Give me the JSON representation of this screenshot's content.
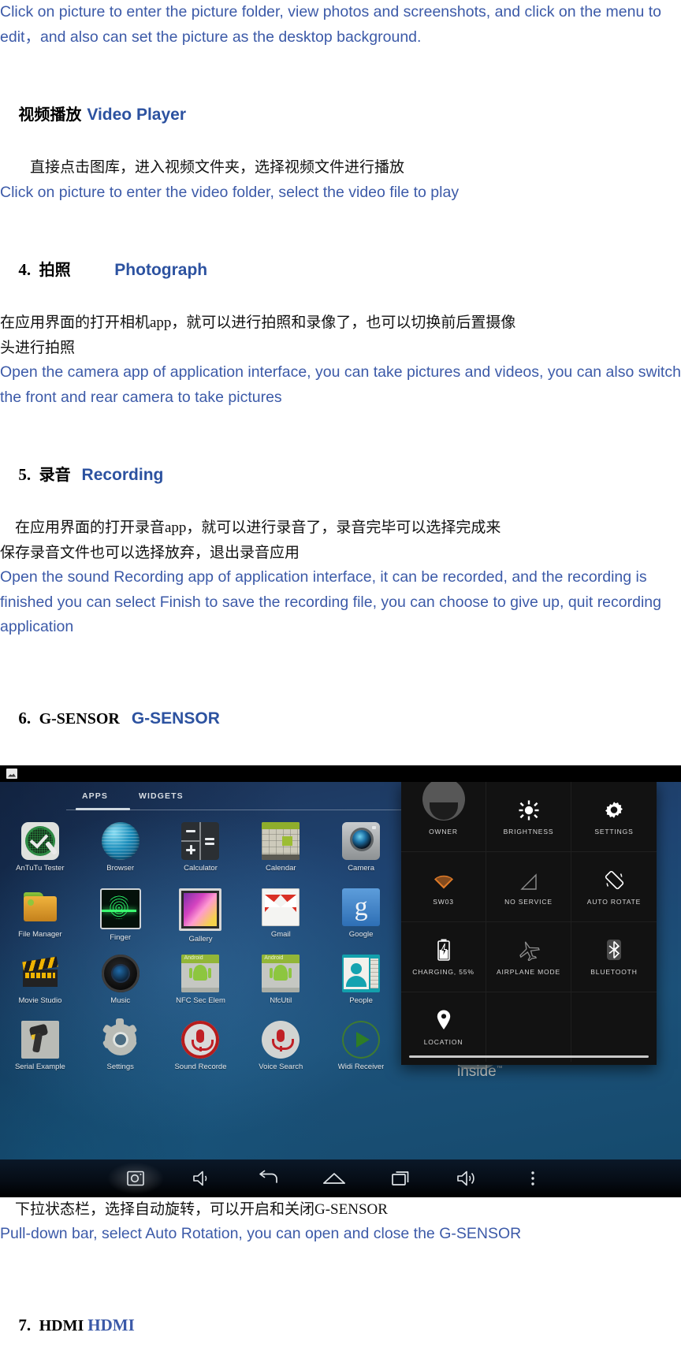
{
  "doc": {
    "para_gallery_en": "Click on picture to enter the picture folder, view photos and screenshots, and click on the menu to edit，and also can set the picture as the desktop background.",
    "video_section": {
      "heading_cn": "视频播放",
      "heading_en": "Video Player",
      "body_cn": "        直接点击图库，进入视频文件夹，选择视频文件进行播放",
      "body_en": "Click on picture to enter the video folder, select the video file to play"
    },
    "photo_section": {
      "number": "4.",
      "heading_cn": "拍照",
      "heading_en": "Photograph",
      "body_cn": "在应用界面的打开相机app，就可以进行拍照和录像了，也可以切换前后置摄像\n头进行拍照",
      "body_en": "Open the camera app of application interface, you can take pictures and videos, you can also switch the front and rear camera to take pictures"
    },
    "recording_section": {
      "number": "5.",
      "heading_cn": "录音",
      "heading_en": "Recording",
      "body_cn": "    在应用界面的打开录音app，就可以进行录音了，录音完毕可以选择完成来\n保存录音文件也可以选择放弃，退出录音应用",
      "body_en": "Open the sound Recording app of application interface, it can be recorded, and the recording is finished you can select Finish to save the recording file, you can choose to give up, quit recording application"
    },
    "gsensor_section": {
      "number": "6.",
      "heading_cn": "G-SENSOR",
      "heading_en": "G-SENSOR",
      "caption_cn": "    下拉状态栏，选择自动旋转，可以开启和关闭G-SENSOR",
      "caption_en": "Pull-down bar, select Auto Rotation, you can open and close the G-SENSOR"
    },
    "hdmi_section": {
      "number": "7.",
      "heading_cn": "HDMI",
      "heading_en": "HDMI"
    }
  },
  "screenshot": {
    "statusbar": {
      "icon": "screenshot-image-icon"
    },
    "launcher": {
      "tabs": [
        {
          "label": "APPS",
          "active": true
        },
        {
          "label": "WIDGETS",
          "active": false
        }
      ],
      "apps": [
        {
          "label": "AnTuTu Tester",
          "icon": "antutu-icon"
        },
        {
          "label": "Browser",
          "icon": "browser-globe-icon"
        },
        {
          "label": "Calculator",
          "icon": "calculator-icon"
        },
        {
          "label": "Calendar",
          "icon": "calendar-icon"
        },
        {
          "label": "Camera",
          "icon": "camera-icon"
        },
        {
          "label": "File Manager",
          "icon": "folder-icon"
        },
        {
          "label": "Finger",
          "icon": "fingerprint-icon"
        },
        {
          "label": "Gallery",
          "icon": "gallery-photo-icon"
        },
        {
          "label": "Gmail",
          "icon": "gmail-envelope-icon"
        },
        {
          "label": "Google",
          "icon": "google-g-icon"
        },
        {
          "label": "Movie Studio",
          "icon": "clapperboard-icon"
        },
        {
          "label": "Music",
          "icon": "speaker-icon"
        },
        {
          "label": "NFC Sec Elem",
          "icon": "android-robot-icon"
        },
        {
          "label": "NfcUtil",
          "icon": "android-robot-icon"
        },
        {
          "label": "People",
          "icon": "contact-card-icon"
        },
        {
          "label": "Serial Example",
          "icon": "barcode-scanner-icon"
        },
        {
          "label": "Settings",
          "icon": "gear-icon"
        },
        {
          "label": "Sound Recorde",
          "icon": "record-microphone-icon"
        },
        {
          "label": "Voice Search",
          "icon": "microphone-icon"
        },
        {
          "label": "Widi Receiver",
          "icon": "play-circle-icon"
        }
      ],
      "wallpaper_logo": "inside",
      "wallpaper_logo_tm": "™"
    },
    "quick_settings": [
      {
        "label": "OWNER",
        "icon": "user-avatar-icon"
      },
      {
        "label": "BRIGHTNESS",
        "icon": "brightness-sun-icon"
      },
      {
        "label": "SETTINGS",
        "icon": "gear-icon"
      },
      {
        "label": "SW03",
        "icon": "wifi-icon"
      },
      {
        "label": "NO SERVICE",
        "icon": "signal-bars-icon"
      },
      {
        "label": "AUTO ROTATE",
        "icon": "auto-rotate-icon"
      },
      {
        "label": "CHARGING, 55%",
        "icon": "battery-charging-icon"
      },
      {
        "label": "AIRPLANE MODE",
        "icon": "airplane-icon"
      },
      {
        "label": "BLUETOOTH",
        "icon": "bluetooth-icon"
      },
      {
        "label": "LOCATION",
        "icon": "location-pin-icon"
      }
    ],
    "navbar": [
      {
        "name": "screenshot-button",
        "icon": "camera-shutter-icon",
        "active": true
      },
      {
        "name": "volume-down-button",
        "icon": "volume-low-icon",
        "active": false
      },
      {
        "name": "back-button",
        "icon": "back-arrow-icon",
        "active": false
      },
      {
        "name": "home-button",
        "icon": "home-icon",
        "active": false
      },
      {
        "name": "recents-button",
        "icon": "recents-icon",
        "active": false
      },
      {
        "name": "volume-up-button",
        "icon": "volume-high-icon",
        "active": false
      },
      {
        "name": "overflow-menu-button",
        "icon": "three-dots-icon",
        "active": false
      }
    ]
  },
  "colors": {
    "english_blue": "#3c5aa8",
    "heading_blue": "#2c52a0",
    "body_black": "#111111",
    "accent_green": "#8dc63f"
  }
}
